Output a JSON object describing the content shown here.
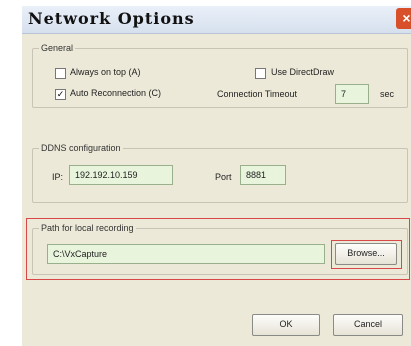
{
  "dialog": {
    "title": "Network Options",
    "close_glyph": "×"
  },
  "general": {
    "legend": "General",
    "always_on_top": {
      "label": "Always on top (A)",
      "checked": false
    },
    "use_directdraw": {
      "label": "Use DirectDraw",
      "checked": false
    },
    "auto_reconnection": {
      "label": "Auto Reconnection (C)",
      "checked": true
    },
    "timeout_label": "Connection Timeout",
    "timeout_value": "7",
    "timeout_unit": "sec"
  },
  "ddns": {
    "legend": "DDNS configuration",
    "ip_label": "IP:",
    "ip_value": "192.192.10.159",
    "port_label": "Port",
    "port_value": "8881"
  },
  "recording": {
    "legend": "Path for local recording",
    "path_value": "C:\\VxCapture",
    "browse_label": "Browse..."
  },
  "footer": {
    "ok_label": "OK",
    "cancel_label": "Cancel"
  },
  "colors": {
    "highlight": "#d84848",
    "field_bg": "#e8f4dc",
    "dialog_bg": "#ece9d8"
  },
  "icons": {
    "close": "close-icon",
    "check": "checkmark-icon"
  }
}
